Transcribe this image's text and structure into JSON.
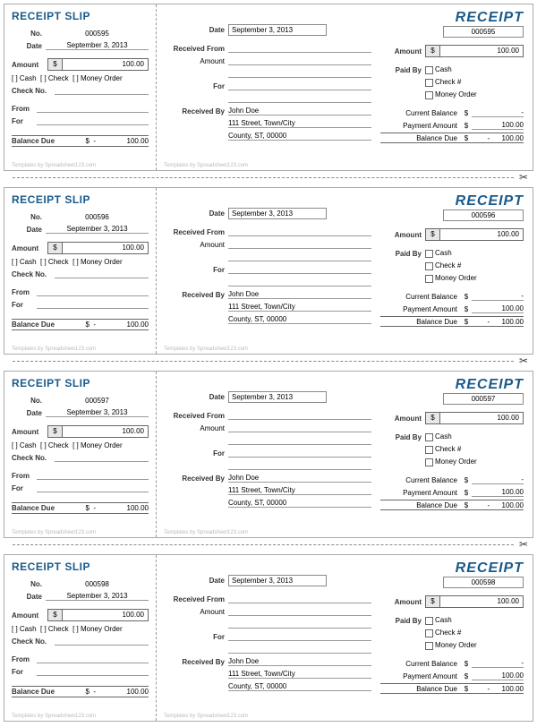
{
  "labels": {
    "slip_title": "RECEIPT SLIP",
    "receipt_title": "RECEIPT",
    "no": "No.",
    "date": "Date",
    "amount": "Amount",
    "cash": "Cash",
    "check": "Check",
    "money_order": "Money Order",
    "check_no": "Check No.",
    "from": "From",
    "for": "For",
    "balance_due": "Balance Due",
    "received_from": "Received From",
    "received_by": "Received By",
    "paid_by": "Paid By",
    "check_hash": "Check #",
    "current_balance": "Current Balance",
    "payment_amount": "Payment Amount",
    "templates_by": "Templates by Spreadsheet123.com",
    "currency": "$",
    "dash": "-"
  },
  "common": {
    "date": "September 3, 2013",
    "amount": "100.00",
    "received_by": "John Doe",
    "address1": "111 Street, Town/City",
    "address2": "County, ST, 00000",
    "current_balance": "-",
    "payment_amount": "100.00",
    "balance_due_amount": "100.00"
  },
  "receipts": [
    {
      "no": "000595"
    },
    {
      "no": "000596"
    },
    {
      "no": "000597"
    },
    {
      "no": "000598"
    }
  ]
}
